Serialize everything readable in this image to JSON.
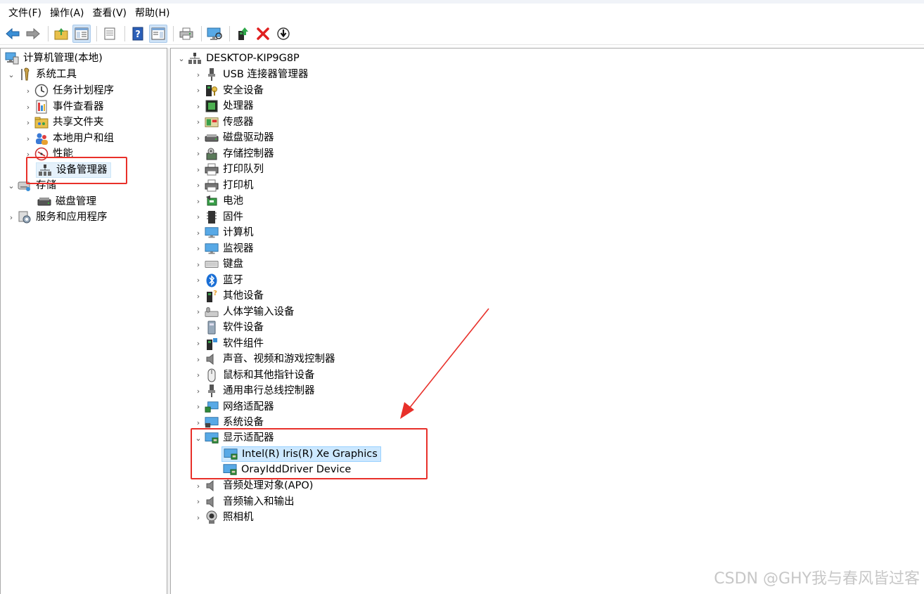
{
  "menu": [
    "文件(F)",
    "操作(A)",
    "查看(V)",
    "帮助(H)"
  ],
  "toolbar": {
    "icons": [
      "back-arrow-icon",
      "forward-arrow-icon",
      "up-folder-icon",
      "show-hide-tree-icon",
      "properties-icon",
      "help-icon",
      "show-action-pane-icon",
      "print-icon",
      "monitor-scan-icon",
      "update-driver-icon",
      "uninstall-icon",
      "disable-device-icon"
    ]
  },
  "left_tree": {
    "root": "计算机管理(本地)",
    "system_tools": "系统工具",
    "task_scheduler": "任务计划程序",
    "event_viewer": "事件查看器",
    "shared_folders": "共享文件夹",
    "local_users": "本地用户和组",
    "performance": "性能",
    "device_manager": "设备管理器",
    "storage": "存储",
    "disk_management": "磁盘管理",
    "services_apps": "服务和应用程序"
  },
  "device_tree": {
    "computer": "DESKTOP-KIP9G8P",
    "categories": [
      {
        "label": "USB 连接器管理器",
        "icon": "usb-icon"
      },
      {
        "label": "安全设备",
        "icon": "security-device-icon"
      },
      {
        "label": "处理器",
        "icon": "processor-icon"
      },
      {
        "label": "传感器",
        "icon": "sensor-icon"
      },
      {
        "label": "磁盘驱动器",
        "icon": "disk-drive-icon"
      },
      {
        "label": "存储控制器",
        "icon": "storage-controller-icon"
      },
      {
        "label": "打印队列",
        "icon": "printer-icon"
      },
      {
        "label": "打印机",
        "icon": "printer-icon"
      },
      {
        "label": "电池",
        "icon": "battery-icon"
      },
      {
        "label": "固件",
        "icon": "firmware-icon"
      },
      {
        "label": "计算机",
        "icon": "monitor-icon"
      },
      {
        "label": "监视器",
        "icon": "monitor-icon"
      },
      {
        "label": "键盘",
        "icon": "keyboard-icon"
      },
      {
        "label": "蓝牙",
        "icon": "bluetooth-icon"
      },
      {
        "label": "其他设备",
        "icon": "other-device-icon"
      },
      {
        "label": "人体学输入设备",
        "icon": "hid-icon"
      },
      {
        "label": "软件设备",
        "icon": "software-device-icon"
      },
      {
        "label": "软件组件",
        "icon": "software-component-icon"
      },
      {
        "label": "声音、视频和游戏控制器",
        "icon": "speaker-icon"
      },
      {
        "label": "鼠标和其他指针设备",
        "icon": "mouse-icon"
      },
      {
        "label": "通用串行总线控制器",
        "icon": "usb-icon"
      },
      {
        "label": "网络适配器",
        "icon": "network-adapter-icon"
      },
      {
        "label": "系统设备",
        "icon": "system-device-icon"
      }
    ],
    "display_adapters": {
      "label": "显示适配器",
      "children": [
        "Intel(R) Iris(R) Xe Graphics",
        "OrayIddDriver Device"
      ]
    },
    "after": [
      {
        "label": "音频处理对象(APO)",
        "icon": "speaker-icon"
      },
      {
        "label": "音频输入和输出",
        "icon": "speaker-icon"
      },
      {
        "label": "照相机",
        "icon": "camera-icon"
      }
    ]
  },
  "watermark": "CSDN @GHY我与春风皆过客",
  "colors": {
    "highlight": "#e8302a",
    "selection": "#cce8ff"
  }
}
